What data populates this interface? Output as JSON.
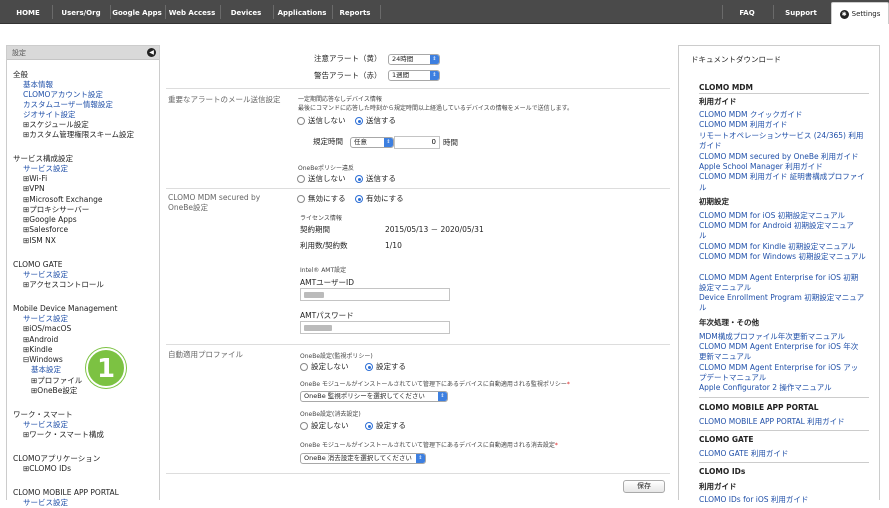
{
  "nav": {
    "left_tabs": [
      "HOME",
      "Users/Org",
      "Google Apps",
      "Web Access",
      "Devices",
      "Applications",
      "Reports"
    ],
    "right_tabs": [
      "FAQ",
      "Support"
    ],
    "settings_label": "Settings"
  },
  "sidebar": {
    "header": "設定",
    "items": [
      {
        "text": "全般",
        "kind": "h"
      },
      {
        "text": "基本情報",
        "kind": "l"
      },
      {
        "text": "CLOMOアカウント設定",
        "kind": "l"
      },
      {
        "text": "カスタムユーザー情報設定",
        "kind": "l"
      },
      {
        "text": "ジオサイト設定",
        "kind": "l"
      },
      {
        "text": "⊞スケジュール設定",
        "kind": "t"
      },
      {
        "text": "⊞カスタム管理権限スキーム設定",
        "kind": "t"
      },
      {
        "text": "サービス構成設定",
        "kind": "h"
      },
      {
        "text": "サービス設定",
        "kind": "l"
      },
      {
        "text": "⊞Wi-Fi",
        "kind": "t"
      },
      {
        "text": "⊞VPN",
        "kind": "t"
      },
      {
        "text": "⊞Microsoft Exchange",
        "kind": "t"
      },
      {
        "text": "⊞プロキシサーバー",
        "kind": "t"
      },
      {
        "text": "⊞Google Apps",
        "kind": "t"
      },
      {
        "text": "⊞Salesforce",
        "kind": "t"
      },
      {
        "text": "⊞ISM NX",
        "kind": "t"
      },
      {
        "text": "CLOMO GATE",
        "kind": "h"
      },
      {
        "text": "サービス設定",
        "kind": "l"
      },
      {
        "text": "⊞アクセスコントロール",
        "kind": "t"
      },
      {
        "text": "Mobile Device Management",
        "kind": "h"
      },
      {
        "text": "サービス設定",
        "kind": "l"
      },
      {
        "text": "⊞iOS/macOS",
        "kind": "t"
      },
      {
        "text": "⊞Android",
        "kind": "t"
      },
      {
        "text": "⊞Kindle",
        "kind": "t"
      },
      {
        "text": "⊟Windows",
        "kind": "t"
      },
      {
        "text": "基本設定",
        "kind": "l"
      },
      {
        "text": "⊞プロファイル",
        "kind": "t"
      },
      {
        "text": "⊞OneBe設定",
        "kind": "t"
      },
      {
        "text": "ワーク・スマート",
        "kind": "h"
      },
      {
        "text": "サービス設定",
        "kind": "l"
      },
      {
        "text": "⊞ワーク・スマート構成",
        "kind": "t"
      },
      {
        "text": "CLOMOアプリケーション",
        "kind": "h"
      },
      {
        "text": "⊞CLOMO IDs",
        "kind": "t"
      },
      {
        "text": "CLOMO MOBILE APP PORTAL",
        "kind": "h"
      },
      {
        "text": "サービス設定",
        "kind": "l"
      }
    ],
    "step_badge": "1"
  },
  "main": {
    "caution_alert_label": "注意アラート（黄）",
    "caution_alert_value": "24時間",
    "warning_alert_label": "警告アラート（赤）",
    "warning_alert_value": "1週間",
    "email_section_label": "重要なアラートのメール送信設定",
    "no_response_title": "一定期間応答なしデバイス情報",
    "no_response_desc": "最後にコマンドに応答した時刻から規定時間以上経過しているデバイスの情報をメールで送信します。",
    "opt_no_send": "送信しない",
    "opt_send": "送信する",
    "period_label": "規定時間",
    "period_select": "任意",
    "period_value": "0",
    "period_unit": "時間",
    "onebe_violation_title": "OneBeポリシー違反",
    "opt_no_send_2": "送信しない",
    "opt_send_2": "送信する",
    "mdm_secured_label": "CLOMO MDM secured by OneBe設定",
    "opt_disable": "無効にする",
    "opt_enable": "有効にする",
    "license_info": "ライセンス情報",
    "contract_period_label": "契約期間",
    "contract_period_value": "2015/05/13 － 2020/05/31",
    "usage_label": "利用数/契約数",
    "usage_value": "1/10",
    "amt_settings": "Intel® AMT設定",
    "amt_user_label": "AMTユーザーID",
    "amt_pass_label": "AMTパスワード",
    "auto_profile_label": "自動適用プロファイル",
    "onebe_monitor_title": "OneBe設定(監視ポリシー)",
    "opt_no_set": "設定しない",
    "opt_set": "設定する",
    "monitor_auto_text": "OneBe モジュールがインストールされていて管理下にあるデバイスに自動適用される監視ポリシー",
    "monitor_select": "OneBe 監視ポリシーを選択してください",
    "onebe_erase_title": "OneBe設定(消去設定)",
    "opt_no_set_2": "設定しない",
    "opt_set_2": "設定する",
    "erase_auto_text": "OneBe モジュールがインストールされていて管理下にあるデバイスに自動適用される消去設定",
    "erase_select": "OneBe 消去設定を選択してください",
    "required_mark": "*",
    "save_label": "保存"
  },
  "downloads": {
    "title": "ドキュメントダウンロード",
    "items": [
      {
        "text": "CLOMO MDM",
        "kind": "h"
      },
      {
        "text": "利用ガイド",
        "kind": "h"
      },
      {
        "text": "CLOMO MDM クイックガイド",
        "kind": "l"
      },
      {
        "text": "CLOMO MDM 利用ガイド",
        "kind": "l"
      },
      {
        "text": "リモートオペレーションサービス (24/365) 利用",
        "kind": "l"
      },
      {
        "text": "ガイド",
        "kind": "l"
      },
      {
        "text": "CLOMO MDM secured by OneBe 利用ガイド",
        "kind": "l"
      },
      {
        "text": "Apple School Manager 利用ガイド",
        "kind": "l"
      },
      {
        "text": "CLOMO MDM 利用ガイド 証明書構成プロファイ",
        "kind": "l"
      },
      {
        "text": "ル",
        "kind": "l"
      },
      {
        "text": "初期設定",
        "kind": "h"
      },
      {
        "text": "CLOMO MDM for iOS 初期設定マニュアル",
        "kind": "l"
      },
      {
        "text": "CLOMO MDM for Android 初期設定マニュア",
        "kind": "l"
      },
      {
        "text": "ル",
        "kind": "l"
      },
      {
        "text": "CLOMO MDM for Kindle 初期設定マニュアル",
        "kind": "l"
      },
      {
        "text": "CLOMO MDM for Windows 初期設定マニュアル",
        "kind": "l"
      },
      {
        "text": "CLOMO MDM Agent Enterprise for iOS 初期",
        "kind": "l"
      },
      {
        "text": "設定マニュアル",
        "kind": "l"
      },
      {
        "text": "Device Enrollment Program 初期設定マニュア",
        "kind": "l"
      },
      {
        "text": "ル",
        "kind": "l"
      },
      {
        "text": "年次処理・その他",
        "kind": "h"
      },
      {
        "text": "MDM構成プロファイル年次更新マニュアル",
        "kind": "l"
      },
      {
        "text": "CLOMO MDM Agent Enterprise for iOS 年次",
        "kind": "l"
      },
      {
        "text": "更新マニュアル",
        "kind": "l"
      },
      {
        "text": "CLOMO MDM Agent Enterprise for iOS アッ",
        "kind": "l"
      },
      {
        "text": "プデートマニュアル",
        "kind": "l"
      },
      {
        "text": "Apple Configurator 2 操作マニュアル",
        "kind": "l"
      },
      {
        "text": "CLOMO MOBILE APP PORTAL",
        "kind": "h"
      },
      {
        "text": "CLOMO MOBILE APP PORTAL 利用ガイド",
        "kind": "l"
      },
      {
        "text": "CLOMO GATE",
        "kind": "h"
      },
      {
        "text": "CLOMO GATE 利用ガイド",
        "kind": "l"
      },
      {
        "text": "CLOMO IDs",
        "kind": "h"
      },
      {
        "text": "利用ガイド",
        "kind": "h"
      },
      {
        "text": "CLOMO IDs for iOS 利用ガイド",
        "kind": "l"
      }
    ]
  }
}
